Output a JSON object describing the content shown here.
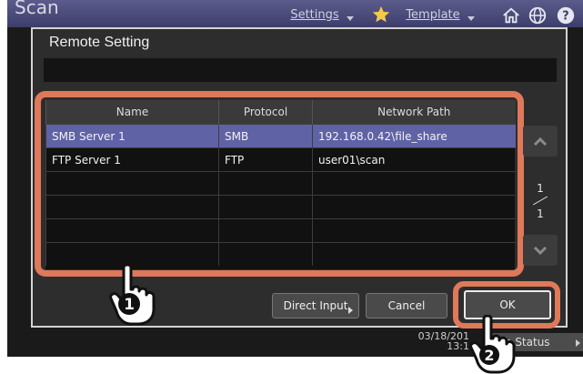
{
  "app": {
    "title": "Scan"
  },
  "topbar": {
    "settings_label": "Settings",
    "template_label": "Template",
    "icons": [
      "star-icon",
      "home-icon",
      "globe-icon",
      "help-icon"
    ]
  },
  "dialog": {
    "title": "Remote Setting",
    "message": "",
    "table": {
      "columns": [
        "Name",
        "Protocol",
        "Network Path"
      ],
      "rows": [
        {
          "name": "SMB Server 1",
          "protocol": "SMB",
          "path": "192.168.0.42\\file_share",
          "selected": true
        },
        {
          "name": "FTP Server 1",
          "protocol": "FTP",
          "path": "user01\\scan",
          "selected": false
        },
        {
          "name": "",
          "protocol": "",
          "path": "",
          "selected": false
        },
        {
          "name": "",
          "protocol": "",
          "path": "",
          "selected": false
        },
        {
          "name": "",
          "protocol": "",
          "path": "",
          "selected": false
        },
        {
          "name": "",
          "protocol": "",
          "path": "",
          "selected": false
        }
      ]
    },
    "pager": {
      "current": "1",
      "total": "1"
    },
    "buttons": {
      "direct_input": "Direct Input",
      "cancel": "Cancel",
      "ok": "OK"
    }
  },
  "statusbar": {
    "date": "03/18/201",
    "time": "13:1",
    "job_status": "Job Status"
  },
  "callouts": {
    "step1": "1",
    "step2": "2"
  },
  "colors": {
    "highlight": "#e0785a",
    "selected_row": "#6062a6",
    "topbar": "#4a4a7a"
  }
}
